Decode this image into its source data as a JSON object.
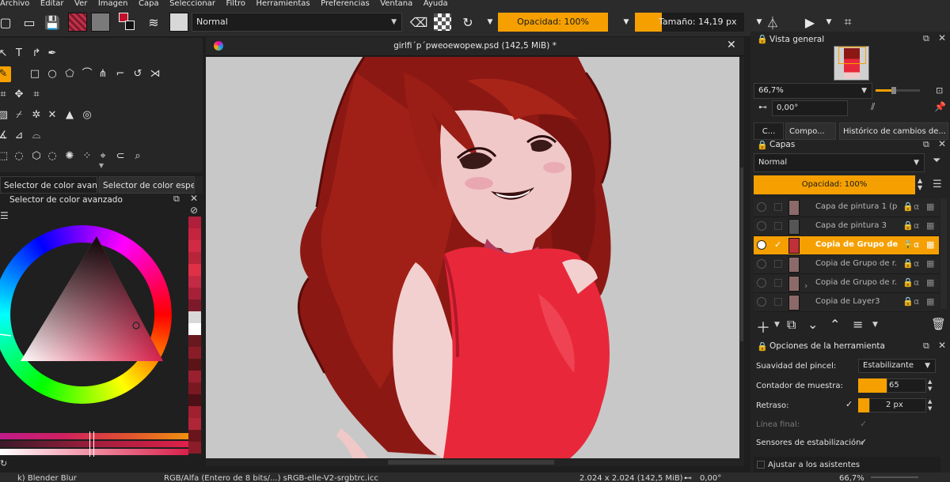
{
  "menu": [
    "Archivo",
    "Editar",
    "Ver",
    "Imagen",
    "Capa",
    "Seleccionar",
    "Filtro",
    "Herramientas",
    "Preferencias",
    "Ventana",
    "Ayuda"
  ],
  "toolbar": {
    "blend_mode": "Normal",
    "opacity_label": "Opacidad: 100%",
    "opacity_fraction": 1.0,
    "size_label": "Tamaño: 14,19 px"
  },
  "document": {
    "title": "girlfi´p´pweoewopew.psd (142,5 MiB) *"
  },
  "color_selector": {
    "tabs": [
      "Selector de color avan...",
      "Selector de color espe..."
    ],
    "title": "Selector de color avanzado",
    "current_color": "#d8204a",
    "palette": [
      "#b01e3c",
      "#c5243f",
      "#d22a45",
      "#b8253b",
      "#e03048",
      "#c42a44",
      "#a82038",
      "#7c1a2a",
      "#d8d8d8",
      "#ffffff",
      "#6a1820",
      "#8a1c28",
      "#5a1418",
      "#9a2030",
      "#7a1822",
      "#4c1016",
      "#a02030",
      "#b02538",
      "#6a141c",
      "#8c1c28"
    ]
  },
  "overview": {
    "title": "Vista general",
    "zoom": "66,7%",
    "rotation": "0,00°"
  },
  "docker_tabs": [
    "C...",
    "Compo...",
    "Histórico de cambios de..."
  ],
  "layers": {
    "title": "Capas",
    "blend_mode": "Normal",
    "opacity_label": "Opacidad:  100%",
    "items": [
      {
        "name": "Capa de pintura 1 (p..."
      },
      {
        "name": "Capa de pintura 3"
      },
      {
        "name": "Copia de Grupo de r..."
      },
      {
        "name": "Copia de Grupo de r..."
      },
      {
        "name": "Copia de Grupo de r..."
      },
      {
        "name": "Copia de Layer3"
      }
    ]
  },
  "tool_options": {
    "title": "Opciones de la herramienta",
    "smoothing_label": "Suavidad del pincel:",
    "smoothing_value": "Estabilizante",
    "sample_count_label": "Contador de muestra:",
    "sample_count_value": "65",
    "delay_label": "Retraso:",
    "delay_value": "2 px",
    "final_line_label": "Línea final:",
    "stabilizer_sensors_label": "Sensores de estabilización:",
    "snap_label": "Ajustar a los asistentes"
  },
  "status": {
    "brush": "k) Blender Blur",
    "color_space": "RGB/Alfa (Entero de 8 bits/...)  sRGB-elle-V2-srgbtrc.icc",
    "dimensions": "2.024 x 2.024 (142,5 MiB)",
    "rotation": "0,00°",
    "zoom": "66,7%"
  },
  "colors": {
    "accent": "#f5a000",
    "panel_bg": "#232323"
  }
}
